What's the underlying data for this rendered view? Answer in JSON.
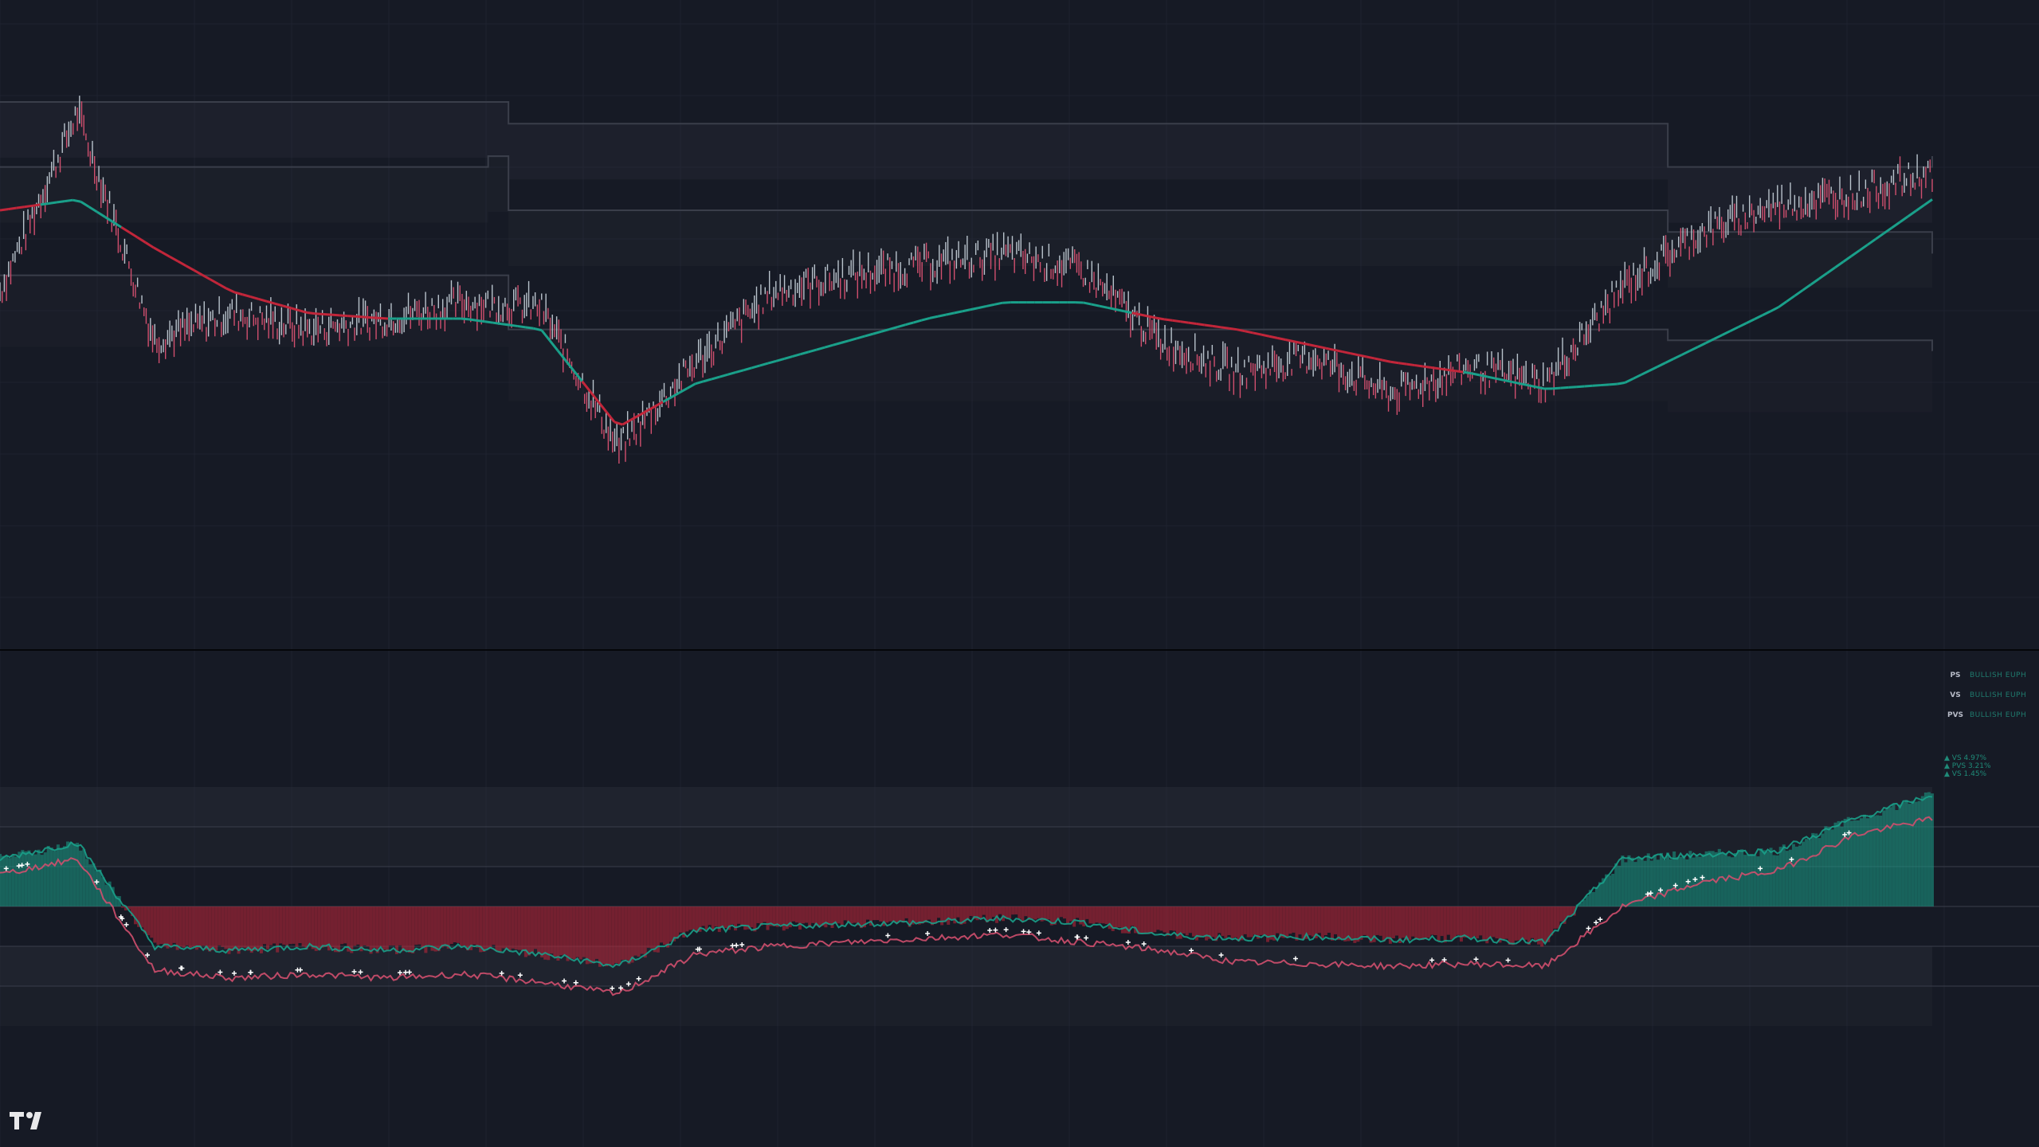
{
  "colors": {
    "background": "#161a25",
    "gridline": "#1e2230",
    "band_fill": "#2a2e39",
    "band_line": "#3a3e4a",
    "bull": "#1aa08a",
    "bear": "#c2263a",
    "neutral": "#8a8e99",
    "price_bull": "#b9c3cc",
    "price_bear": "#d04f6e",
    "marker": "#ffffff",
    "pane_divider": "#05060a"
  },
  "logo": "tradingview-logo",
  "legend": {
    "rows": [
      {
        "key": "PS",
        "value": "BULLISH EUPH"
      },
      {
        "key": "VS",
        "value": "BULLISH EUPH"
      },
      {
        "key": "PVS",
        "value": "BULLISH EUPH"
      }
    ]
  },
  "stats": {
    "rows": [
      {
        "label": "▲ VS 4.97%"
      },
      {
        "label": "▲ PVS 3.21%"
      },
      {
        "label": "▲ VS 1.45%"
      }
    ]
  },
  "chart_data": [
    {
      "type": "line",
      "pane": "price",
      "title": "",
      "xlabel": "",
      "ylabel": "",
      "x_count": 2420,
      "series": [
        {
          "values_sample": [
            0.55,
            0.88,
            0.46,
            0.51,
            0.48,
            0.5,
            0.53,
            0.52,
            0.26,
            0.42,
            0.55,
            0.58,
            0.6,
            0.62,
            0.59,
            0.46,
            0.4,
            0.43,
            0.36,
            0.41,
            0.38,
            0.56,
            0.66,
            0.71,
            0.73,
            0.77
          ]
        },
        {
          "values_sample": [
            0.7,
            0.72,
            0.63,
            0.55,
            0.51,
            0.5,
            0.5,
            0.48,
            0.3,
            0.38,
            0.42,
            0.46,
            0.5,
            0.53,
            0.53,
            0.5,
            0.48,
            0.45,
            0.42,
            0.4,
            0.37,
            0.38,
            0.45,
            0.52,
            0.62,
            0.72
          ]
        }
      ]
    },
    {
      "type": "area",
      "pane": "oscillator",
      "title": "",
      "xlabel": "",
      "ylabel": "",
      "x_count": 2420,
      "series": [
        {
          "values_sample": [
            0.6,
            0.8,
            -0.5,
            -0.55,
            -0.5,
            -0.55,
            -0.5,
            -0.6,
            -0.75,
            -0.3,
            -0.25,
            -0.22,
            -0.2,
            -0.15,
            -0.2,
            -0.35,
            -0.4,
            -0.38,
            -0.42,
            -0.4,
            -0.45,
            0.6,
            0.65,
            0.7,
            1.1,
            1.4
          ]
        },
        {
          "values_sample": [
            0.4,
            0.6,
            -0.8,
            -0.9,
            -0.85,
            -0.9,
            -0.85,
            -0.95,
            -1.1,
            -0.6,
            -0.5,
            -0.45,
            -0.4,
            -0.35,
            -0.45,
            -0.55,
            -0.7,
            -0.72,
            -0.75,
            -0.72,
            -0.75,
            0.0,
            0.3,
            0.45,
            0.9,
            1.1
          ]
        }
      ]
    }
  ]
}
